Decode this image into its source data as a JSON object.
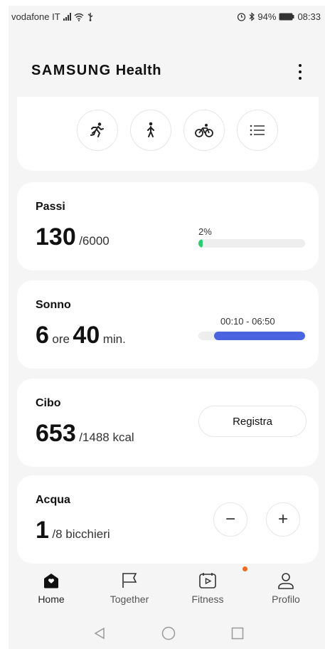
{
  "status_bar": {
    "carrier": "vodafone IT",
    "battery": "94%",
    "time": "08:33"
  },
  "header": {
    "brand": "SAMSUNG",
    "title": "Health"
  },
  "activities": [
    "run-icon",
    "walk-icon",
    "bike-icon",
    "list-icon"
  ],
  "steps": {
    "title": "Passi",
    "value": "130",
    "goal": "/6000",
    "percent_label": "2%",
    "progress": 0.02,
    "color": "#2ecc71"
  },
  "sleep": {
    "title": "Sonno",
    "hours": "6",
    "hours_unit": "ore",
    "minutes": "40",
    "minutes_unit": "min.",
    "range": "00:10 - 06:50",
    "color": "#4a63e0"
  },
  "food": {
    "title": "Cibo",
    "value": "653",
    "goal": "/1488 kcal",
    "button": "Registra"
  },
  "water": {
    "title": "Acqua",
    "value": "1",
    "goal": "/8 bicchieri",
    "minus": "−",
    "plus": "+"
  },
  "bottom_nav": {
    "home": "Home",
    "together": "Together",
    "fitness": "Fitness",
    "profile": "Profilo",
    "badge_color": "#f26b21"
  }
}
